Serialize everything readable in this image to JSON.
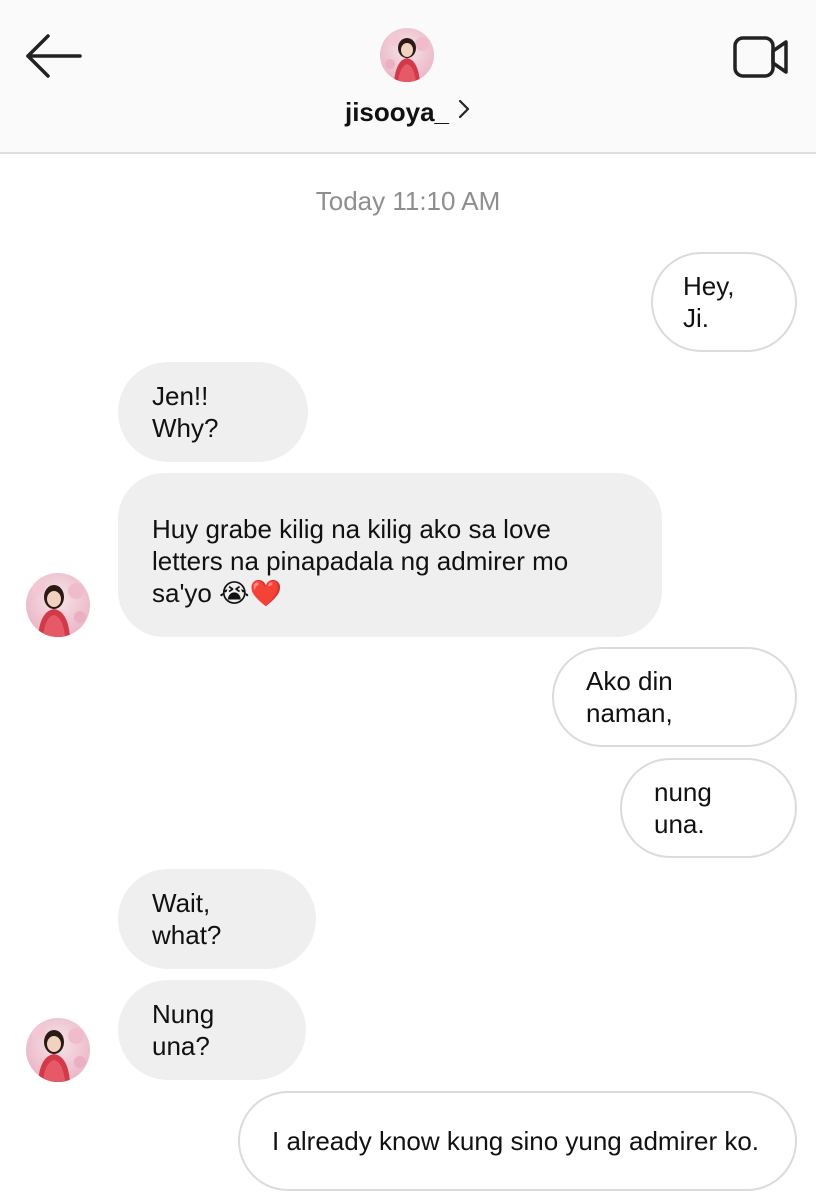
{
  "header": {
    "username": "jisooya_",
    "back_icon": "arrow-left-icon",
    "video_icon": "video-camera-icon"
  },
  "thread": {
    "timestamp": "Today 11:10 AM",
    "messages": [
      {
        "from": "me",
        "text": "Hey, Ji."
      },
      {
        "from": "them",
        "text": "Jen!! Why?"
      },
      {
        "from": "them",
        "lines": [
          "Huy grabe kilig na kilig ako sa love",
          "letters na pinapadala ng admirer mo",
          "sa'yo 😭❤️"
        ]
      },
      {
        "from": "me",
        "text": "Ako din naman,"
      },
      {
        "from": "me",
        "text": "nung una."
      },
      {
        "from": "them",
        "text": "Wait, what?"
      },
      {
        "from": "them",
        "text": "Nung una?"
      },
      {
        "from": "me",
        "text": "I already know kung sino yung admirer ko."
      }
    ]
  },
  "colors": {
    "incoming_bubble": "#efefef",
    "outgoing_border": "#dbdbdb",
    "timestamp": "#8e8e8e",
    "header_bg": "#fafafa"
  }
}
